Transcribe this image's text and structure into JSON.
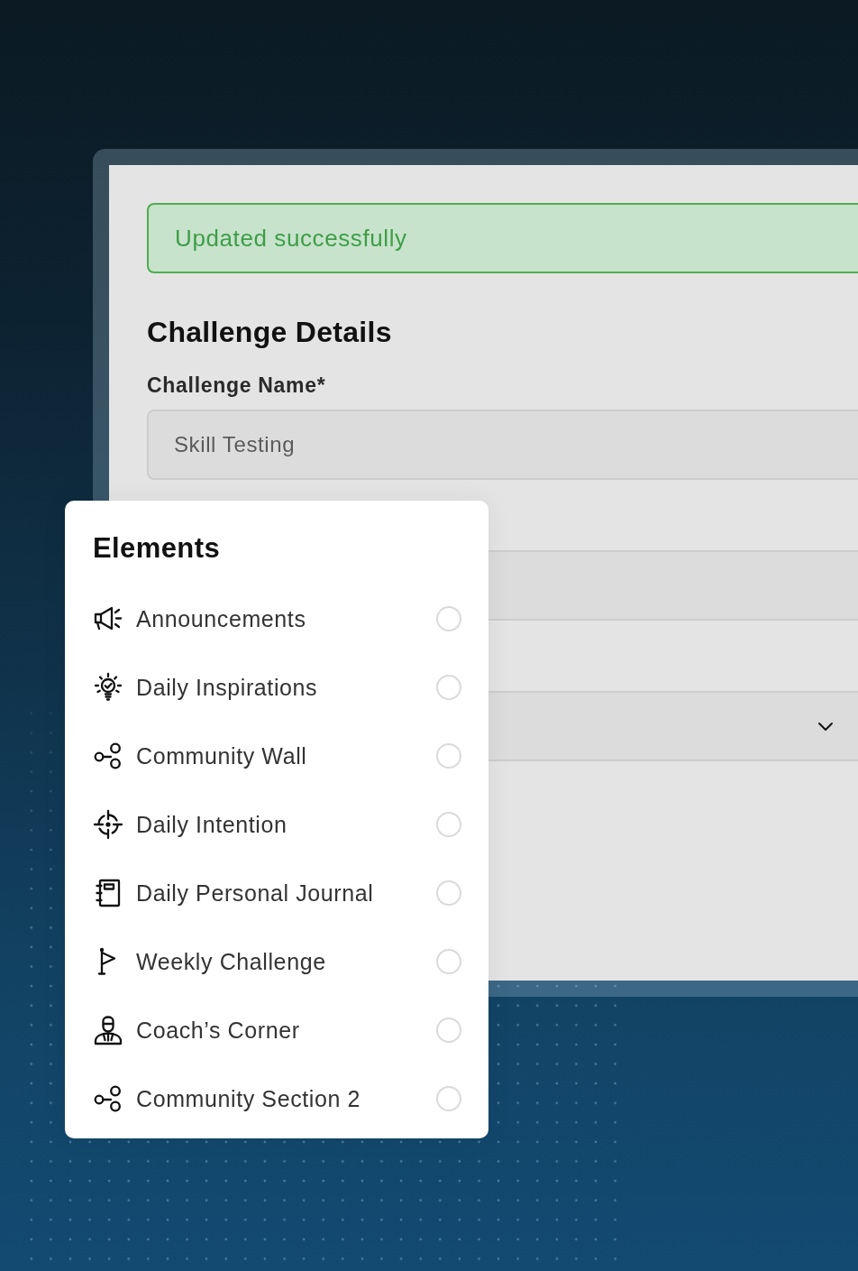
{
  "form": {
    "alert": {
      "kind": "success",
      "text": "Updated successfully"
    },
    "title": "Challenge Details",
    "fields": [
      {
        "kind": "text",
        "label": "Challenge Name*",
        "value": "Skill Testing"
      },
      {
        "kind": "text"
      },
      {
        "kind": "select"
      }
    ]
  },
  "elements_popup": {
    "title": "Elements",
    "items": [
      {
        "kind": "announcements",
        "label": "Announcements",
        "selected": false
      },
      {
        "kind": "inspirations",
        "label": "Daily Inspirations",
        "selected": false
      },
      {
        "kind": "community",
        "label": "Community Wall",
        "selected": false
      },
      {
        "kind": "intention",
        "label": "Daily Intention",
        "selected": false
      },
      {
        "kind": "journal",
        "label": "Daily Personal Journal",
        "selected": false
      },
      {
        "kind": "challenge",
        "label": "Weekly Challenge",
        "selected": false
      },
      {
        "kind": "coach",
        "label": "Coach’s Corner",
        "selected": false
      },
      {
        "kind": "community",
        "label": "Community Section 2",
        "selected": false
      }
    ]
  }
}
